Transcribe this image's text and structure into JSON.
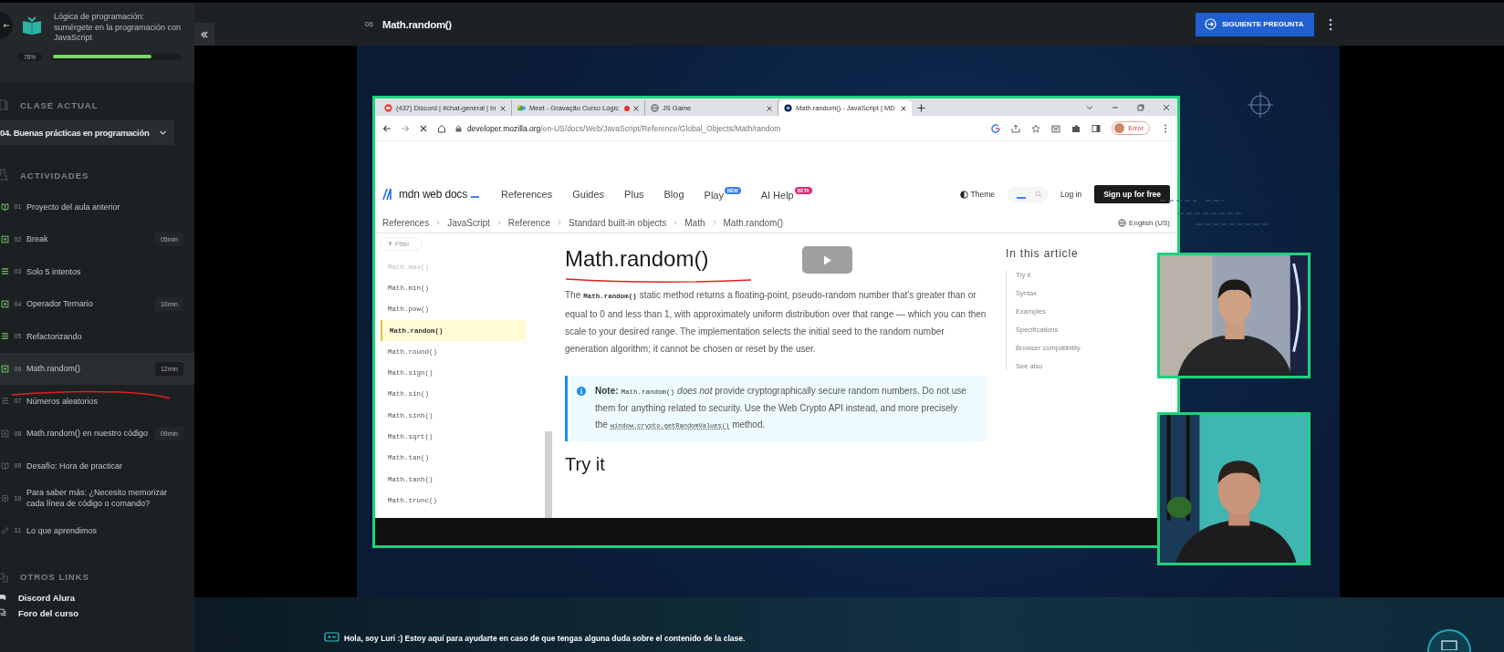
{
  "course": {
    "title": "Lógica de programación: sumérgete en la programación con JavaScript",
    "progress_label": "78%",
    "level": 0.78
  },
  "sidebar": {
    "current_heading": "CLASE ACTUAL",
    "current_class": "04. Buenas prácticas en programación",
    "activities_heading": "ACTIVIDADES",
    "activities": [
      {
        "number": "01",
        "title": "Proyecto del aula anterior",
        "kind": "reading",
        "completed": true,
        "selected": false
      },
      {
        "number": "02",
        "title": "Break",
        "duration": "05min",
        "kind": "video",
        "completed": true,
        "selected": false
      },
      {
        "number": "03",
        "title": "Solo 5 intentos",
        "kind": "text",
        "completed": true,
        "selected": false
      },
      {
        "number": "04",
        "title": "Operador Ternario",
        "duration": "10min",
        "kind": "video",
        "completed": true,
        "selected": false
      },
      {
        "number": "05",
        "title": "Refactorizando",
        "kind": "text",
        "completed": true,
        "selected": false
      },
      {
        "number": "06",
        "title": "Math.random()",
        "duration": "12min",
        "kind": "video",
        "completed": true,
        "selected": true
      },
      {
        "number": "07",
        "title": "Números aleatorios",
        "kind": "text",
        "completed": false,
        "selected": false
      },
      {
        "number": "08",
        "title": "Math.random() en nuestro código",
        "duration": "09min",
        "kind": "video",
        "completed": false,
        "selected": false
      },
      {
        "number": "09",
        "title": "Desafío: Hora de practicar",
        "kind": "reading",
        "completed": false,
        "selected": false
      },
      {
        "number": "10",
        "title": "Para saber más: ¿Necesito memorizar cada línea de código o comando?",
        "kind": "info",
        "completed": false,
        "selected": false
      },
      {
        "number": "11",
        "title": "Lo que aprendimos",
        "kind": "summary",
        "completed": false,
        "selected": false
      }
    ],
    "links_heading": "OTROS LINKS",
    "links": [
      {
        "label": "Discord Alura",
        "kind": "discord"
      },
      {
        "label": "Foro del curso",
        "kind": "forum"
      }
    ]
  },
  "topbar": {
    "number": "06",
    "title": "Math.random()",
    "next_button": "SIGUIENTE PREGUNTA"
  },
  "browser": {
    "tabs": [
      {
        "label": "(437) Discord | #chat-general | In",
        "kind": "discord",
        "selected": false,
        "recording": false
      },
      {
        "label": "Meet - Gravação Curso Lógic",
        "kind": "meet",
        "selected": false,
        "recording": true
      },
      {
        "label": "JS Game",
        "kind": "globe",
        "selected": false,
        "recording": false
      },
      {
        "label": "Math.random() - JavaScript | MD",
        "kind": "mdn",
        "selected": true,
        "recording": false
      }
    ],
    "url_host": "developer.mozilla.org",
    "url_path": "/en-US/docs/Web/JavaScript/Reference/Global_Objects/Math/random",
    "profile": "Error"
  },
  "mdn": {
    "logo": "mdn web docs",
    "nav": [
      {
        "label": "References"
      },
      {
        "label": "Guides"
      },
      {
        "label": "Plus"
      },
      {
        "label": "Blog"
      },
      {
        "label": "Play",
        "badge": {
          "text": "NEW",
          "color": "#3d7dff"
        }
      },
      {
        "label": "AI Help",
        "badge": {
          "text": "BETA",
          "color": "#e0287b"
        }
      }
    ],
    "theme": "Theme",
    "login": "Log in",
    "signup": "Sign up for free",
    "breadcrumbs": [
      "References",
      "JavaScript",
      "Reference",
      "Standard built-in objects",
      "Math",
      "Math.random()"
    ],
    "language": "English (US)",
    "filter_placeholder": "Filter",
    "nav_items": [
      {
        "label": "Math.max()",
        "selected": false,
        "faded": true
      },
      {
        "label": "Math.min()",
        "selected": false,
        "faded": false
      },
      {
        "label": "Math.pow()",
        "selected": false,
        "faded": false
      },
      {
        "label": "Math.random()",
        "selected": true,
        "faded": false
      },
      {
        "label": "Math.round()",
        "selected": false,
        "faded": false
      },
      {
        "label": "Math.sign()",
        "selected": false,
        "faded": false
      },
      {
        "label": "Math.sin()",
        "selected": false,
        "faded": false
      },
      {
        "label": "Math.sinh()",
        "selected": false,
        "faded": false
      },
      {
        "label": "Math.sqrt()",
        "selected": false,
        "faded": false
      },
      {
        "label": "Math.tan()",
        "selected": false,
        "faded": false
      },
      {
        "label": "Math.tanh()",
        "selected": false,
        "faded": false
      },
      {
        "label": "Math.trunc()",
        "selected": false,
        "faded": false
      }
    ],
    "title": "Math.random()",
    "intro": {
      "before": "The",
      "code": "Math.random()",
      "after": "static method returns a floating-point, pseudo-random number that's greater than or equal to 0 and less than 1, with approximately uniform distribution over that range — which you can then scale to your desired range. The implementation selects the initial seed to the random number generation algorithm; it cannot be chosen or reset by the user."
    },
    "note": {
      "label": "Note:",
      "code": "Math.random()",
      "emphasis": "does not",
      "text": "provide cryptographically secure random numbers. Do not use them for anything related to security. Use the Web Crypto API instead, and more precisely the",
      "link": "window.crypto.getRandomValues()",
      "end": "method."
    },
    "section": "Try it",
    "toc_heading": "In this article",
    "toc": [
      "Try it",
      "Syntax",
      "Examples",
      "Specifications",
      "Browser compatibility",
      "See also"
    ]
  },
  "assistant": {
    "message": "Hola, soy Luri :) Estoy aquí para ayudarte en caso de que tengas alguna duda sobre el contenido de la clase."
  }
}
